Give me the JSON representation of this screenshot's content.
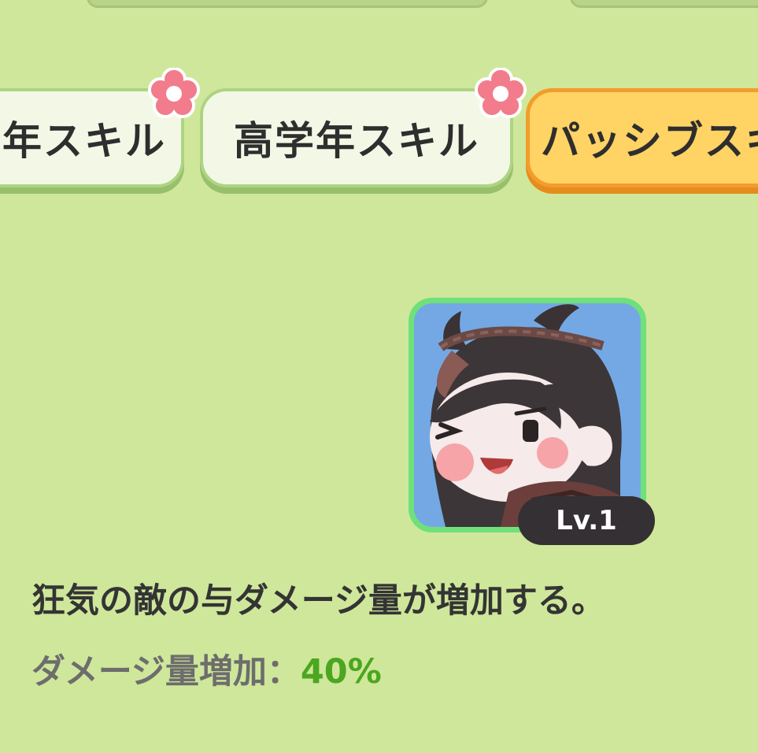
{
  "tabs": [
    {
      "label": "年スキル",
      "state": "inactive",
      "has_flower_badge": true
    },
    {
      "label": "高学年スキル",
      "state": "inactive",
      "has_flower_badge": true
    },
    {
      "label": "パッシブスキ",
      "state": "active",
      "has_flower_badge": false
    }
  ],
  "skill": {
    "level": "Lv.1",
    "description": "狂気の敵の与ダメージ量が増加する。",
    "stat_label": "ダメージ量増加：",
    "stat_value": "40%"
  },
  "icons": {
    "tab_badge": "pink-flower-icon",
    "skill_portrait": "character-portrait"
  },
  "colors": {
    "background": "#cfe79a",
    "tab_inactive": "#f3f8e6",
    "tab_active": "#ffd364",
    "tab_active_border": "#f39c2c",
    "card_border": "#6fe07a",
    "stat_value": "#4ca620"
  }
}
